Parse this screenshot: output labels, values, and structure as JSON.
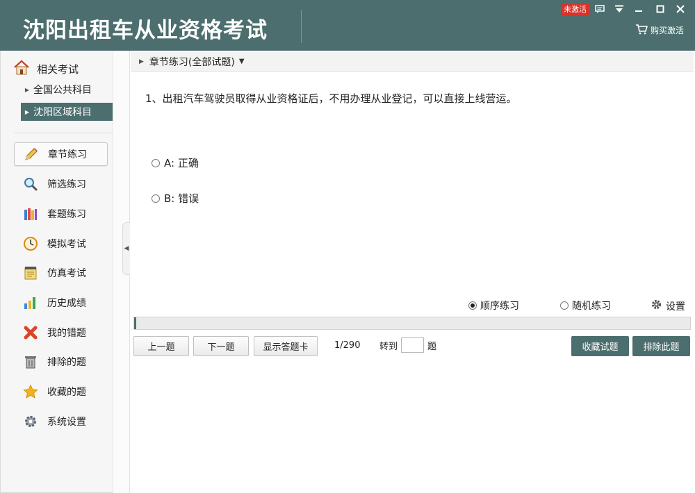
{
  "app": {
    "title": "沈阳出租车从业资格考试"
  },
  "header": {
    "inactive_badge": "未激活",
    "buy_label": "购买激活"
  },
  "sidebar": {
    "related_label": "相关考试",
    "subjects": [
      {
        "label": "全国公共科目",
        "active": false
      },
      {
        "label": "沈阳区域科目",
        "active": true
      }
    ],
    "nav": [
      {
        "label": "章节练习",
        "icon": "pencil-icon",
        "active": true
      },
      {
        "label": "筛选练习",
        "icon": "search-icon"
      },
      {
        "label": "套题练习",
        "icon": "books-icon"
      },
      {
        "label": "模拟考试",
        "icon": "clock-icon"
      },
      {
        "label": "仿真考试",
        "icon": "notepad-icon"
      },
      {
        "label": "历史成绩",
        "icon": "bar-chart-icon"
      },
      {
        "label": "我的错题",
        "icon": "red-x-icon"
      },
      {
        "label": "排除的题",
        "icon": "trash-icon"
      },
      {
        "label": "收藏的题",
        "icon": "star-icon"
      },
      {
        "label": "系统设置",
        "icon": "gear-icon"
      }
    ]
  },
  "breadcrumb": {
    "label": "章节练习(全部试题)"
  },
  "question": {
    "text": "1、出租汽车驾驶员取得从业资格证后，不用办理从业登记，可以直接上线营运。",
    "options": [
      {
        "key": "A",
        "label": "A: 正确"
      },
      {
        "key": "B",
        "label": "B: 错误"
      }
    ]
  },
  "modes": {
    "sequential": "顺序练习",
    "random": "随机练习",
    "settings": "设置",
    "selected": "sequential"
  },
  "progress": {
    "fraction": 0.0034
  },
  "controls": {
    "prev": "上一题",
    "next": "下一题",
    "show_card": "显示答题卡",
    "counter": "1/290",
    "goto_prefix": "转到",
    "goto_suffix": "题",
    "goto_value": "",
    "favorite": "收藏试题",
    "exclude": "排除此题"
  },
  "colors": {
    "theme": "#4c6e6e",
    "badge": "#d9322a"
  }
}
